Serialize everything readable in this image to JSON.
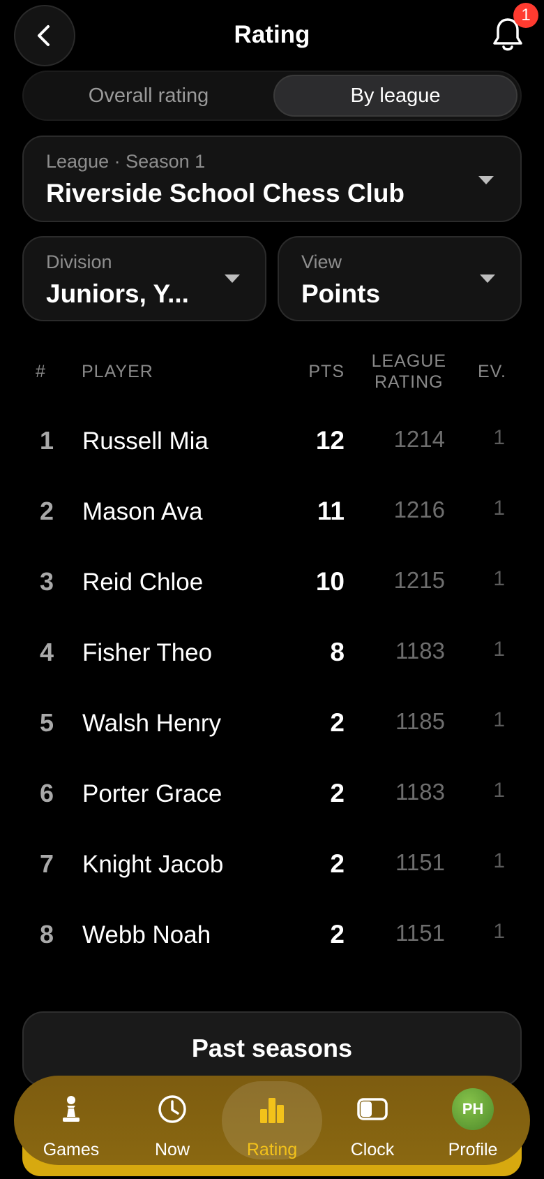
{
  "header": {
    "title": "Rating",
    "notification_count": "1"
  },
  "segmented": {
    "overall": "Overall rating",
    "by_league": "By league",
    "selected": "By league"
  },
  "league_select": {
    "label": "League · Season 1",
    "value": "Riverside School Chess Club"
  },
  "division_select": {
    "label": "Division",
    "value": "Juniors, Y..."
  },
  "view_select": {
    "label": "View",
    "value": "Points"
  },
  "table": {
    "headers": {
      "rank": "#",
      "player": "PLAYER",
      "pts": "PTS",
      "rating_line1": "LEAGUE",
      "rating_line2": "RATING",
      "events": "EV."
    },
    "rows": [
      {
        "rank": "1",
        "name": "Russell Mia",
        "pts": "12",
        "rating": "1214",
        "events": "1"
      },
      {
        "rank": "2",
        "name": "Mason Ava",
        "pts": "11",
        "rating": "1216",
        "events": "1"
      },
      {
        "rank": "3",
        "name": "Reid Chloe",
        "pts": "10",
        "rating": "1215",
        "events": "1"
      },
      {
        "rank": "4",
        "name": "Fisher Theo",
        "pts": "8",
        "rating": "1183",
        "events": "1"
      },
      {
        "rank": "5",
        "name": "Walsh Henry",
        "pts": "2",
        "rating": "1185",
        "events": "1"
      },
      {
        "rank": "6",
        "name": "Porter Grace",
        "pts": "2",
        "rating": "1183",
        "events": "1"
      },
      {
        "rank": "7",
        "name": "Knight Jacob",
        "pts": "2",
        "rating": "1151",
        "events": "1"
      },
      {
        "rank": "8",
        "name": "Webb Noah",
        "pts": "2",
        "rating": "1151",
        "events": "1"
      }
    ]
  },
  "past_seasons_label": "Past seasons",
  "tabbar": {
    "games": "Games",
    "now": "Now",
    "rating": "Rating",
    "clock": "Clock",
    "profile": "Profile",
    "profile_initials": "PH",
    "active": "Rating"
  },
  "colors": {
    "accent": "#f3c21a",
    "tabbar": "#8a6811",
    "badge": "#ff3b30",
    "background": "#000000"
  }
}
